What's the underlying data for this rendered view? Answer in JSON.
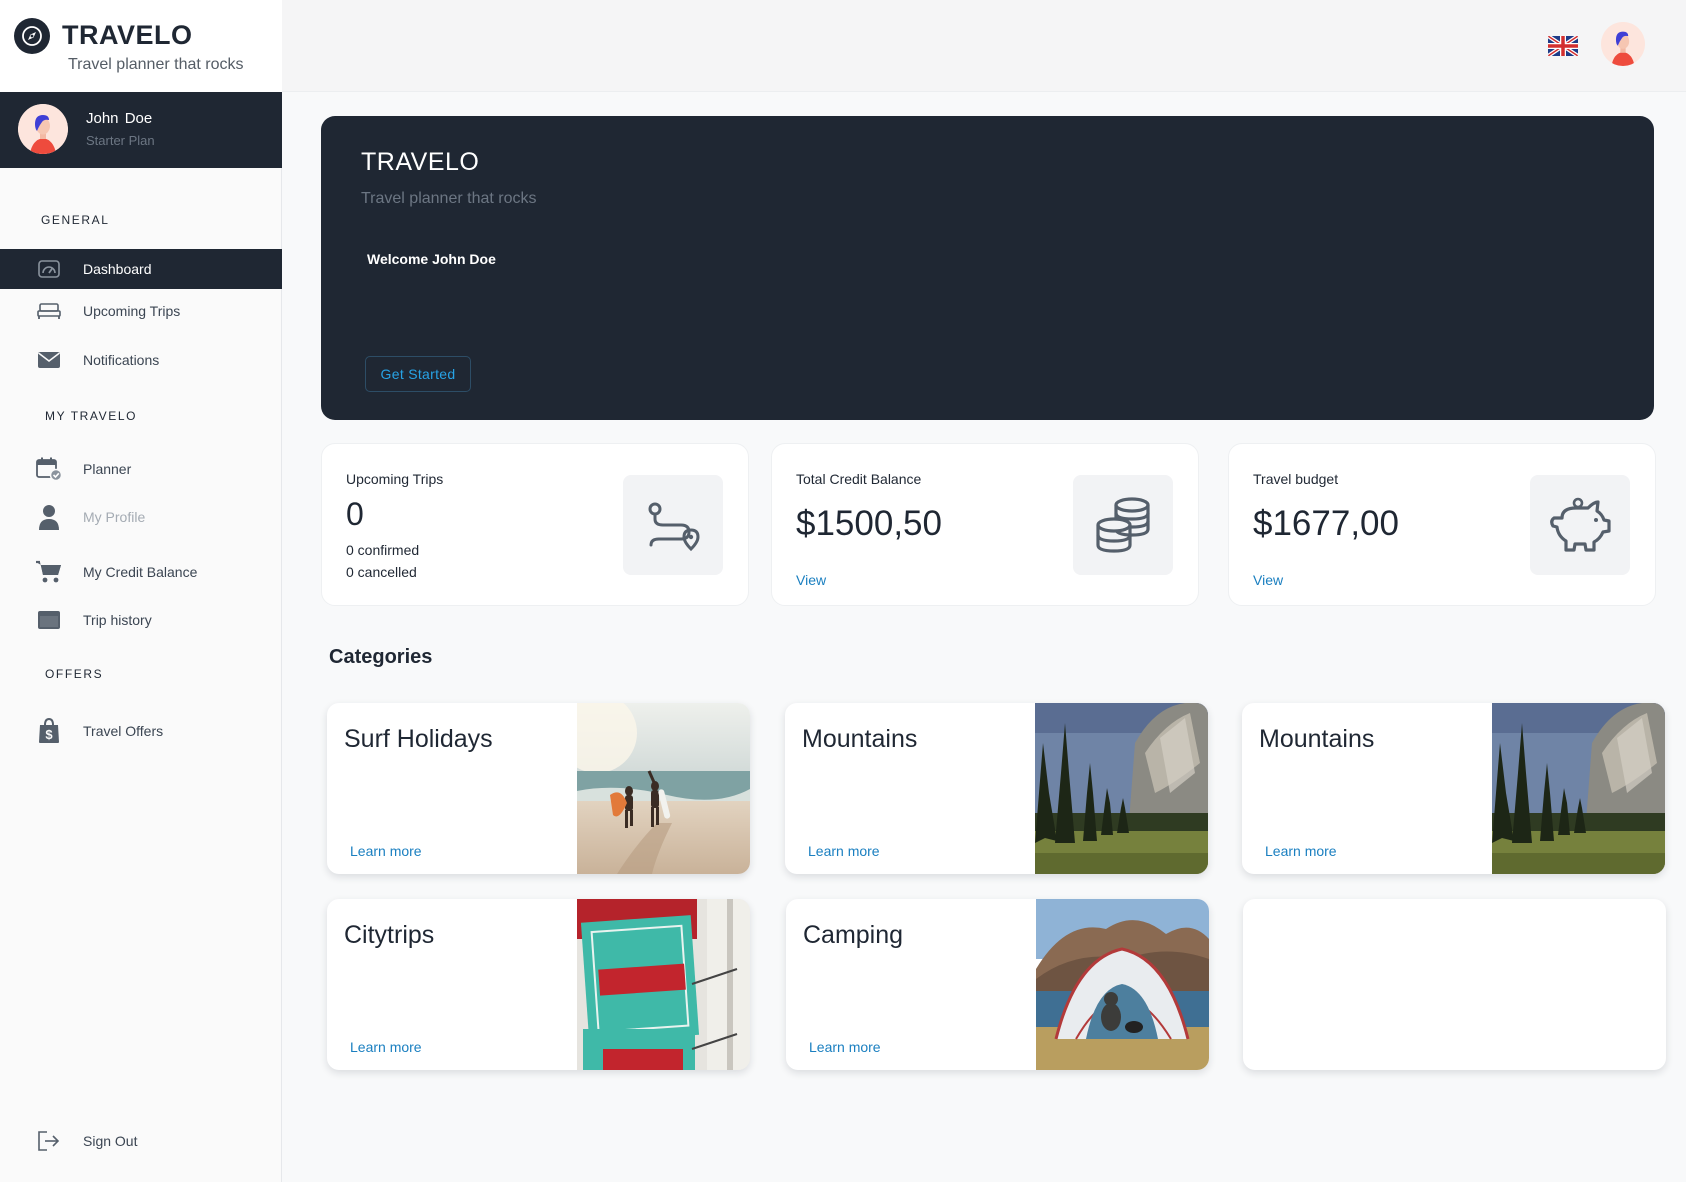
{
  "app": {
    "name": "TRAVELO",
    "tagline": "Travel planner that rocks"
  },
  "user": {
    "name": "John Doe",
    "plan": "Starter Plan"
  },
  "sidebar": {
    "sections": [
      {
        "label": "GENERAL",
        "items": [
          {
            "label": "Dashboard",
            "icon": "gauge-icon",
            "active": true
          },
          {
            "label": "Upcoming Trips",
            "icon": "bed-icon"
          },
          {
            "label": "Notifications",
            "icon": "envelope-icon"
          }
        ]
      },
      {
        "label": "MY TRAVELO",
        "items": [
          {
            "label": "Planner",
            "icon": "calendar-check-icon"
          },
          {
            "label": "My Profile",
            "icon": "user-icon",
            "muted": true
          },
          {
            "label": "My Credit Balance",
            "icon": "cart-icon"
          },
          {
            "label": "Trip history",
            "icon": "window-icon"
          }
        ]
      },
      {
        "label": "OFFERS",
        "items": [
          {
            "label": "Travel Offers",
            "icon": "shopping-bag-dollar-icon"
          }
        ]
      }
    ],
    "sign_out": "Sign Out"
  },
  "topbar": {
    "language_flag": "uk-flag-icon",
    "avatar": "user-avatar-icon"
  },
  "hero": {
    "title": "TRAVELO",
    "subtitle": "Travel planner that rocks",
    "welcome": "Welcome John Doe",
    "button": "Get Started"
  },
  "stats": {
    "upcoming": {
      "title": "Upcoming Trips",
      "value": "0",
      "confirmed": "0  confirmed",
      "cancelled": "0 cancelled",
      "icon": "route-icon"
    },
    "credit": {
      "title": "Total Credit Balance",
      "value": "$1500,50",
      "link": "View",
      "icon": "coins-icon"
    },
    "budget": {
      "title": "Travel budget",
      "value": "$1677,00",
      "link": "View",
      "icon": "piggy-bank-icon"
    }
  },
  "categories": {
    "heading": "Categories",
    "items": [
      {
        "title": "Surf Holidays",
        "link": "Learn more"
      },
      {
        "title": "Mountains",
        "link": "Learn more"
      },
      {
        "title": "Mountains",
        "link": "Learn more"
      },
      {
        "title": "Citytrips",
        "link": "Learn more"
      },
      {
        "title": "Camping",
        "link": "Learn more"
      }
    ]
  },
  "colors": {
    "dark": "#1f2733",
    "accent": "#1a7fc0",
    "background": "#f8f9fa"
  }
}
